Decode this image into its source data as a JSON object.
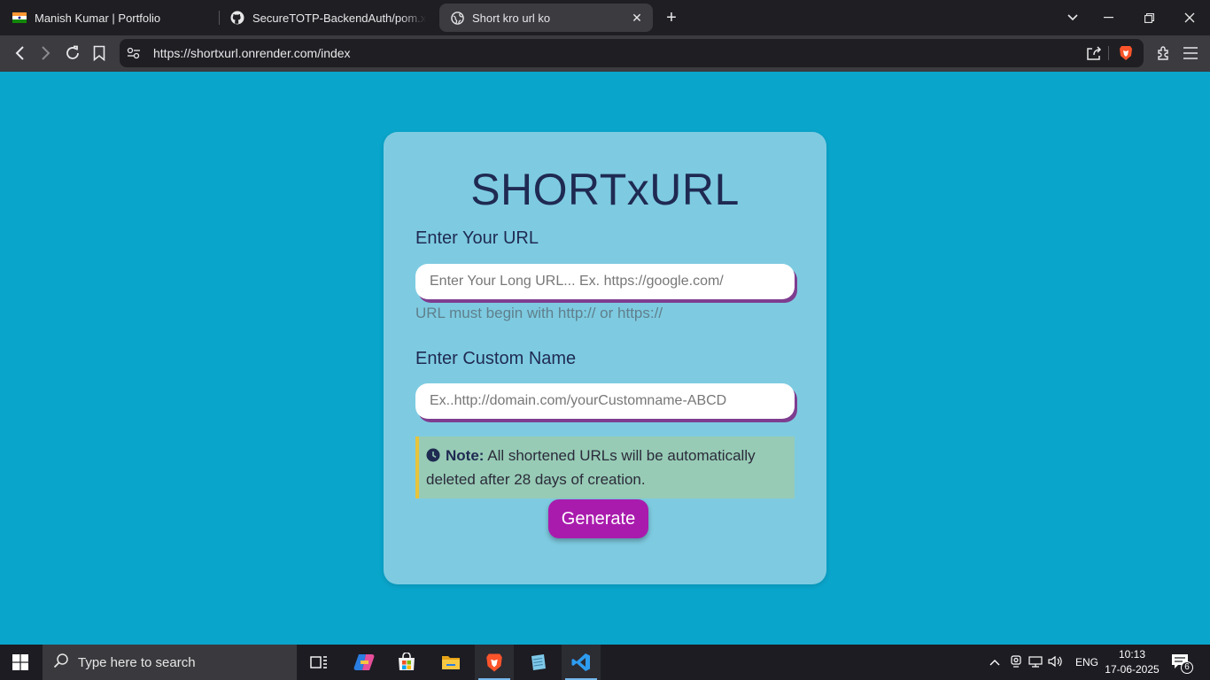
{
  "browser": {
    "tabs": [
      {
        "title": "Manish Kumar | Portfolio",
        "icon": "india-flag-icon"
      },
      {
        "title": "SecureTOTP-BackendAuth/pom.xml at",
        "icon": "github-icon"
      },
      {
        "title": "Short kro url ko",
        "icon": "globe-icon",
        "active": true
      }
    ],
    "url": "https://shortxurl.onrender.com/index"
  },
  "app": {
    "title": "SHORTxURL",
    "url_label": "Enter Your URL",
    "url_placeholder": "Enter Your Long URL... Ex. https://google.com/",
    "url_hint": "URL must begin with http:// or https://",
    "name_label": "Enter Custom Name",
    "name_placeholder": "Ex..http://domain.com/yourCustomname-ABCD",
    "note_bold": "Note:",
    "note_text": " All shortened URLs will be automatically deleted after 28 days of creation.",
    "generate_label": "Generate"
  },
  "taskbar": {
    "search_placeholder": "Type here to search",
    "language": "ENG",
    "time": "10:13",
    "date": "17-06-2025",
    "notification_count": "6"
  },
  "colors": {
    "page_bg": "#0aa5cb",
    "card_bg": "#7ecbe1",
    "button_bg": "#a91bad",
    "note_bg": "#97cbb5",
    "note_accent": "#e6c33a"
  }
}
